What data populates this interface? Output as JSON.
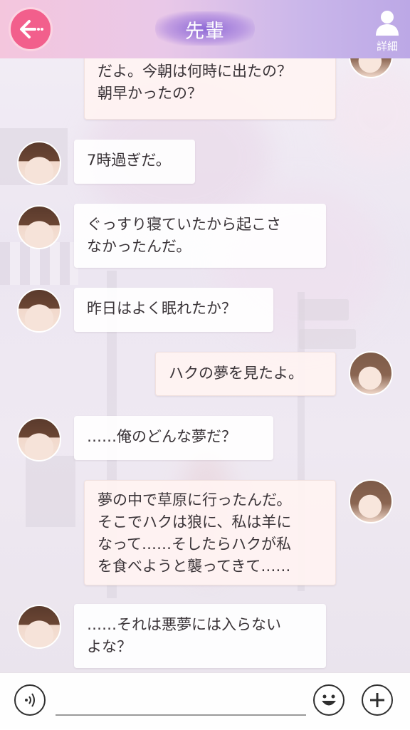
{
  "header": {
    "title": "先輩",
    "detail_label": "詳細"
  },
  "messages": [
    {
      "sender": "me",
      "text": "だよ。今朝は何時に出たの？\n朝早かったの？"
    },
    {
      "sender": "other",
      "text": "7時過ぎだ。"
    },
    {
      "sender": "other",
      "text": "ぐっすり寝ていたから起こさ\nなかったんだ。"
    },
    {
      "sender": "other",
      "text": "昨日はよく眠れたか？"
    },
    {
      "sender": "me",
      "text": "ハクの夢を見たよ。"
    },
    {
      "sender": "other",
      "text": "……俺のどんな夢だ？"
    },
    {
      "sender": "me",
      "text": "夢の中で草原に行ったんだ。\nそこでハクは狼に、私は羊に\nなって……そしたらハクが私\nを食べようと襲ってきて……"
    },
    {
      "sender": "other",
      "text": "……それは悪夢には入らない\nよな？"
    }
  ],
  "icons": {
    "back": "back-arrow-icon",
    "detail": "person-icon",
    "voice": "voice-icon",
    "emoji": "emoji-icon",
    "add": "plus-icon"
  },
  "colors": {
    "accent": "#f25f8c",
    "header_left": "#f4c6dd",
    "header_right": "#bca8e6"
  }
}
